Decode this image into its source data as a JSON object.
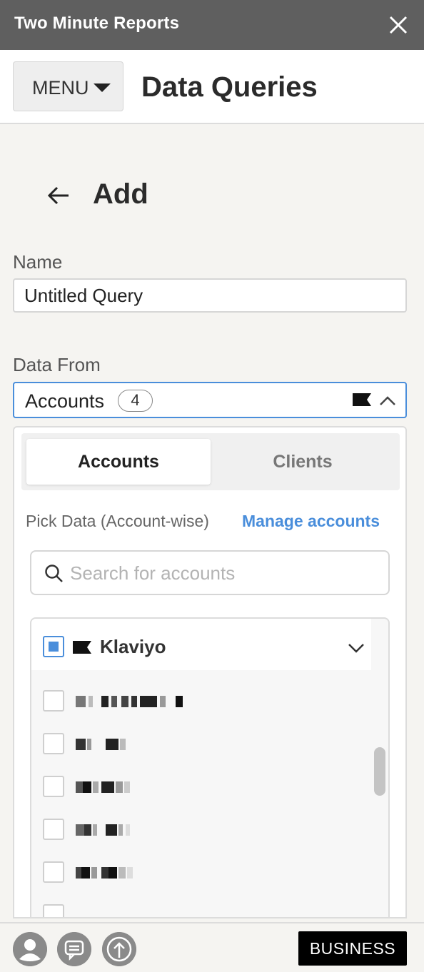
{
  "app": {
    "title": "Two Minute Reports",
    "close_icon": "close-icon"
  },
  "header": {
    "menu_label": "MENU",
    "page_title": "Data Queries"
  },
  "form": {
    "heading": "Add",
    "name_label": "Name",
    "name_value": "Untitled Query",
    "data_from_label": "Data From",
    "data_from_value": "Accounts",
    "data_from_count": "4"
  },
  "panel": {
    "tabs": [
      {
        "label": "Accounts",
        "active": true
      },
      {
        "label": "Clients",
        "active": false
      }
    ],
    "pick_label": "Pick Data (Account-wise)",
    "manage_link": "Manage accounts",
    "search_placeholder": "Search for accounts",
    "group": {
      "name": "Klaviyo",
      "state": "partial",
      "icon": "klaviyo-flag-icon"
    },
    "accounts": [
      {
        "name": "[redacted]",
        "checked": false
      },
      {
        "name": "[redacted]",
        "checked": false
      },
      {
        "name": "[redacted]",
        "checked": false
      },
      {
        "name": "[redacted]",
        "checked": false
      },
      {
        "name": "[redacted]",
        "checked": false
      }
    ]
  },
  "footer": {
    "icons": [
      "user-avatar-icon",
      "chat-feedback-icon",
      "upgrade-arrow-icon"
    ],
    "plan_badge": "BUSINESS"
  },
  "colors": {
    "accent": "#4a8edb",
    "titlebar": "#5f5f5f",
    "background": "#f5f4f1"
  }
}
